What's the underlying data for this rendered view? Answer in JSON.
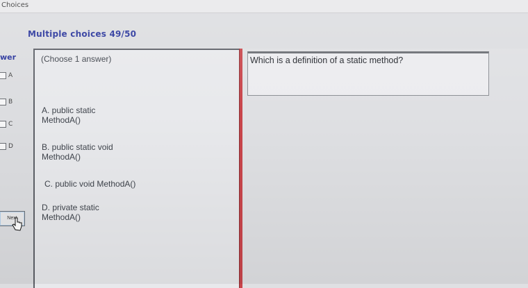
{
  "window": {
    "title": "Choices"
  },
  "quiz": {
    "heading": "Multiple choices 49/50",
    "answer_label": "wer",
    "instruction": "(Choose 1 answer)",
    "question": "Which is a definition of a static method?",
    "checkboxes": [
      "A",
      "B",
      "C",
      "D"
    ],
    "options": [
      "A. public static\nMethodA()",
      "B. public static void\nMethodA()",
      "C. public void MethodA()",
      "D. private static\nMethodA()"
    ],
    "next_label": "Next"
  },
  "colors": {
    "heading": "#27339b",
    "divider": "#c8454b",
    "panel": "#e8e9ec"
  }
}
